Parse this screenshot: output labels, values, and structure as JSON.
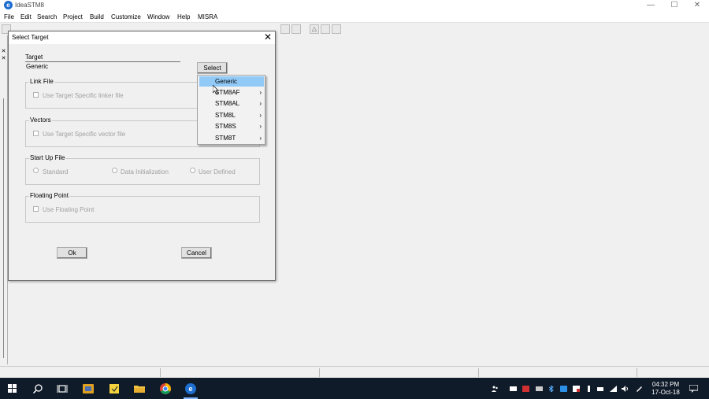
{
  "window": {
    "title": "IdeaSTM8",
    "app_icon_letter": "e",
    "minimize": "—",
    "maximize": "☐",
    "close": "✕"
  },
  "menu": [
    "File",
    "Edit",
    "Search",
    "Project",
    "Build",
    "Customize",
    "Window",
    "Help",
    "MISRA"
  ],
  "dialog": {
    "title": "Select Target",
    "close": "✕",
    "target_label": "Target",
    "target_value": "Generic",
    "select_button": "Select",
    "link_file": {
      "label": "Link File",
      "checkbox": "Use Target Specific linker file"
    },
    "vectors": {
      "label": "Vectors",
      "checkbox": "Use Target Specific vector file"
    },
    "startup": {
      "label": "Start Up File",
      "options": [
        "Standard",
        "Data Initialization",
        "User Defined"
      ]
    },
    "floating": {
      "label": "Floating Point",
      "checkbox": "Use Floating Point"
    },
    "ok_button": "Ok",
    "cancel_button": "Cancel"
  },
  "dropdown": {
    "items": [
      {
        "label": "Generic",
        "submenu": false,
        "selected": true
      },
      {
        "label": "STM8AF",
        "submenu": true,
        "selected": false
      },
      {
        "label": "STM8AL",
        "submenu": true,
        "selected": false
      },
      {
        "label": "STM8L",
        "submenu": true,
        "selected": false
      },
      {
        "label": "STM8S",
        "submenu": true,
        "selected": false
      },
      {
        "label": "STM8T",
        "submenu": true,
        "selected": false
      }
    ],
    "arrow": "›"
  },
  "taskbar": {
    "time": "04:32 PM",
    "date": "17-Oct-18"
  },
  "colors": {
    "selection": "#91c9f7",
    "taskbar": "#101b2a",
    "app_icon": "#1e6fd0"
  }
}
